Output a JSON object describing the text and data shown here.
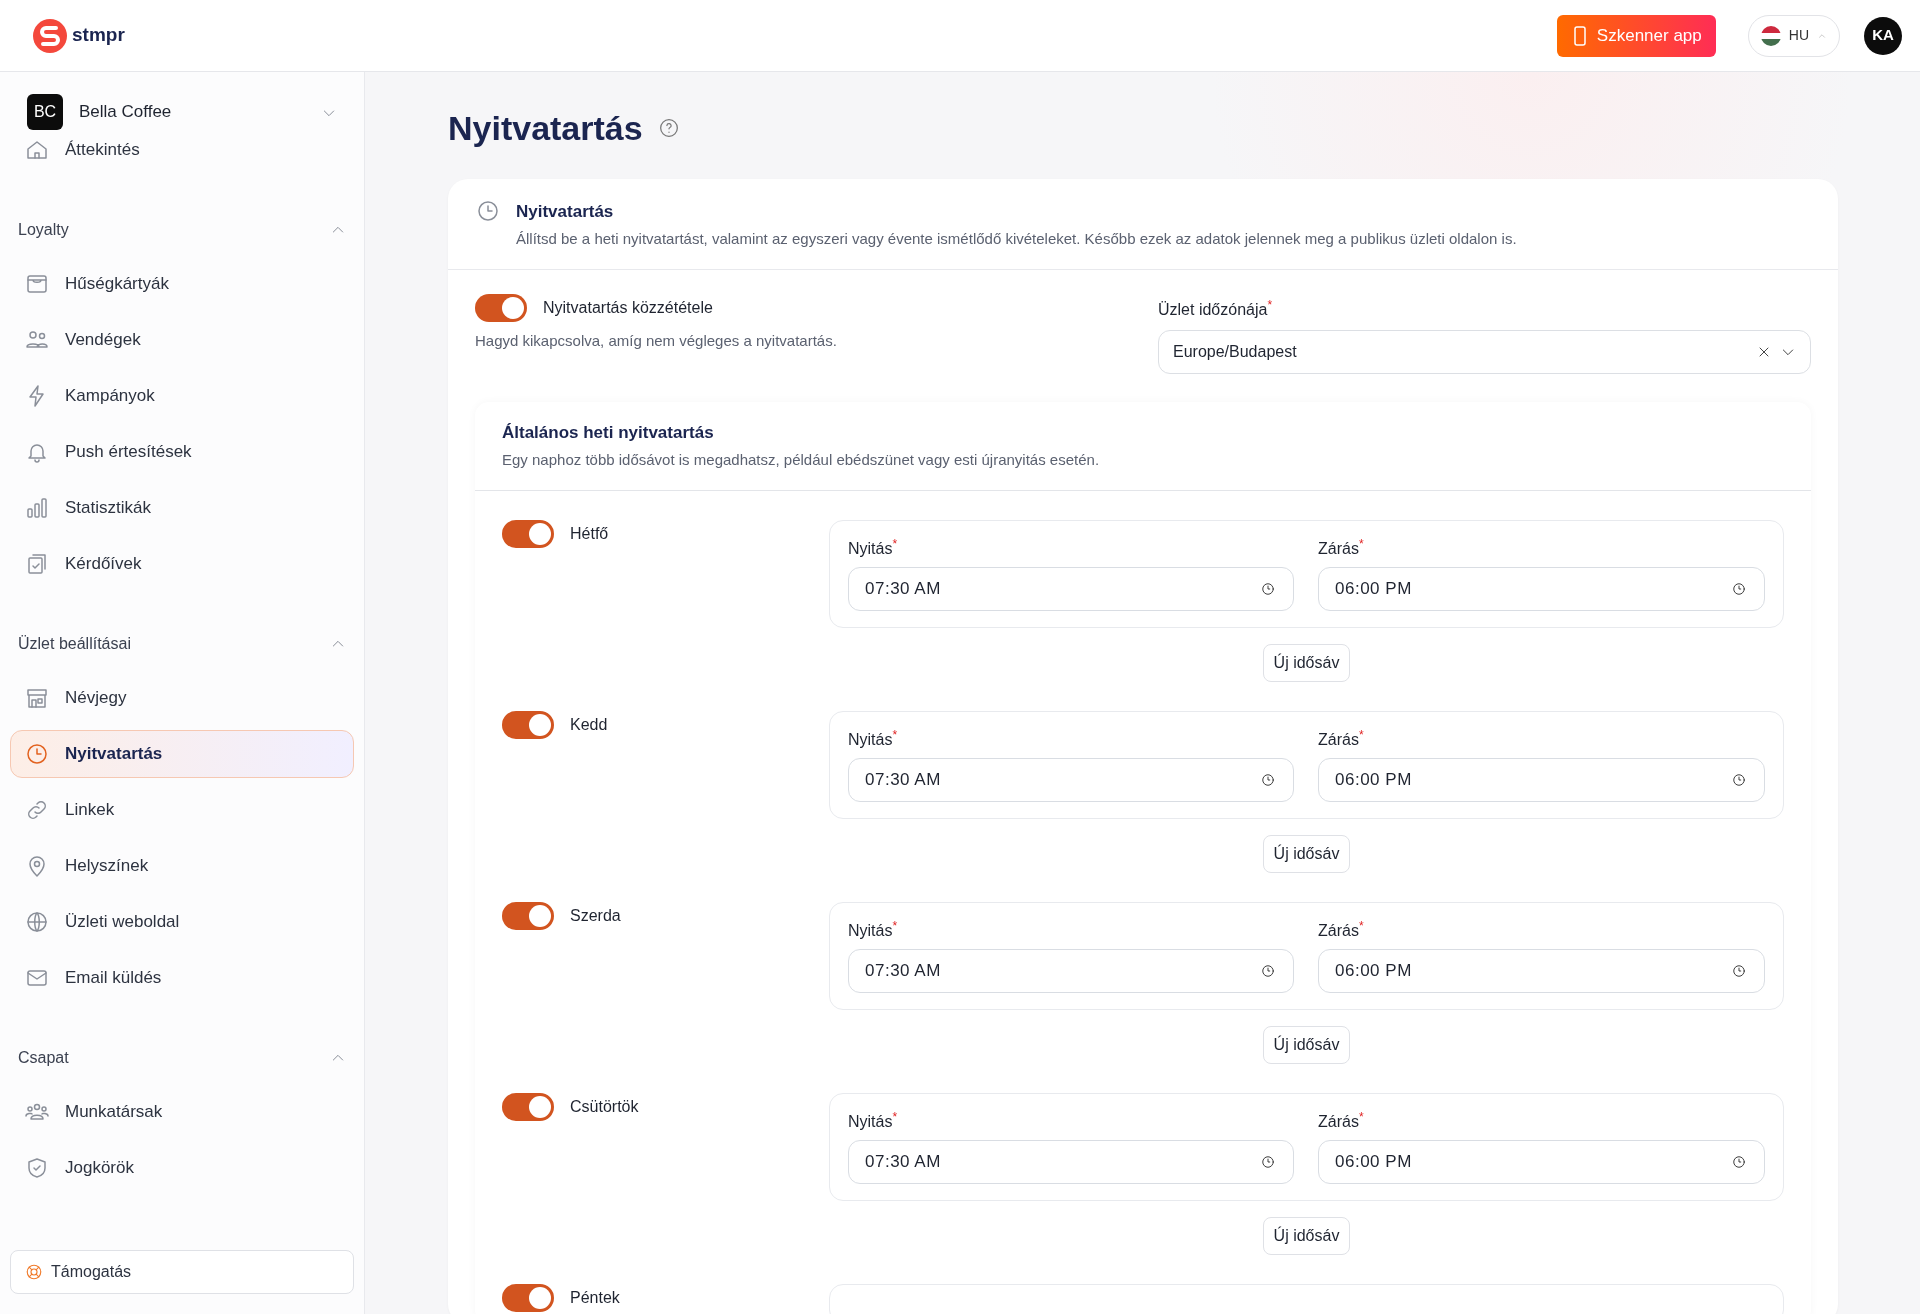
{
  "header": {
    "logo_text": "stmpr",
    "scanner_button": "Szkenner app",
    "language": "HU",
    "avatar": "KA"
  },
  "sidebar": {
    "business": {
      "initials": "BC",
      "name": "Bella Coffee"
    },
    "top_items": [
      {
        "label": "Áttekintés",
        "selected": false
      }
    ],
    "sections": [
      {
        "title": "Loyalty",
        "expanded": true,
        "items": [
          {
            "label": "Hűségkártyák",
            "selected": false
          },
          {
            "label": "Vendégek",
            "selected": false
          },
          {
            "label": "Kampányok",
            "selected": false
          },
          {
            "label": "Push értesítések",
            "selected": false
          },
          {
            "label": "Statisztikák",
            "selected": false
          },
          {
            "label": "Kérdőívek",
            "selected": false
          }
        ]
      },
      {
        "title": "Üzlet beállításai",
        "expanded": true,
        "items": [
          {
            "label": "Névjegy",
            "selected": false
          },
          {
            "label": "Nyitvatartás",
            "selected": true
          },
          {
            "label": "Linkek",
            "selected": false
          },
          {
            "label": "Helyszínek",
            "selected": false
          },
          {
            "label": "Üzleti weboldal",
            "selected": false
          },
          {
            "label": "Email küldés",
            "selected": false
          }
        ]
      },
      {
        "title": "Csapat",
        "expanded": true,
        "items": [
          {
            "label": "Munkatársak",
            "selected": false
          },
          {
            "label": "Jogkörök",
            "selected": false
          }
        ]
      }
    ],
    "support": "Támogatás"
  },
  "page": {
    "title": "Nyitvatartás",
    "card": {
      "title": "Nyitvatartás",
      "description": "Állítsd be a heti nyitvatartást, valamint az egyszeri vagy évente ismétlődő kivételeket. Később ezek az adatok jelennek meg a publikus üzleti oldalon is.",
      "publish": {
        "label": "Nyitvatartás közzététele",
        "on": true,
        "help": "Hagyd kikapcsolva, amíg nem végleges a nyitvatartás."
      },
      "timezone": {
        "label": "Üzlet időzónája$^{*}$",
        "value": "Europe/Budapest"
      },
      "weekly": {
        "title": "Általános heti nyitvatartás",
        "description": "Egy naphoz több idősávot is megadhatsz, például ebédszünet vagy esti újranyitás esetén.",
        "days": [
          {
            "name": "Hétfő",
            "on": true,
            "slots": [
              [
                {
                  "label": "Nyitás$^{*}$",
                  "value": "07:30 AM"
                },
                {
                  "label": "Zárás$^{*}$",
                  "value": "06:00 PM"
                }
              ]
            ],
            "add_label": "Új idősáv"
          },
          {
            "name": "Kedd",
            "on": true,
            "slots": [
              [
                {
                  "label": "Nyitás$^{*}$",
                  "value": "07:30 AM"
                },
                {
                  "label": "Zárás$^{*}$",
                  "value": "06:00 PM"
                }
              ]
            ],
            "add_label": "Új idősáv"
          },
          {
            "name": "Szerda",
            "on": true,
            "slots": [
              [
                {
                  "label": "Nyitás$^{*}$",
                  "value": "07:30 AM"
                },
                {
                  "label": "Zárás$^{*}$",
                  "value": "06:00 PM"
                }
              ]
            ],
            "add_label": "Új idősáv"
          },
          {
            "name": "Csütörtök",
            "on": true,
            "slots": [
              [
                {
                  "label": "Nyitás$^{*}$",
                  "value": "07:30 AM"
                },
                {
                  "label": "Zárás$^{*}$",
                  "value": "06:00 PM"
                }
              ]
            ],
            "add_label": "Új idősáv"
          },
          {
            "name": "Péntek",
            "on": true
          }
        ]
      }
    }
  }
}
